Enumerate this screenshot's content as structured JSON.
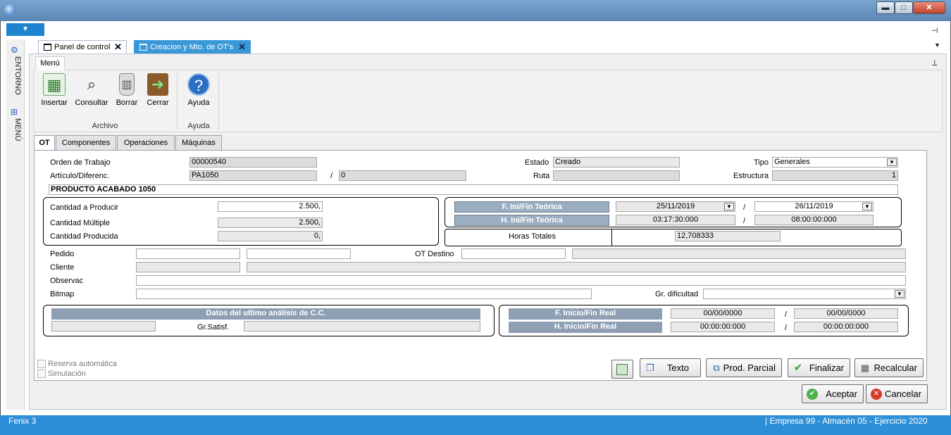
{
  "window": {
    "controls": {
      "minimize": "▬",
      "maximize": "□",
      "close": "✕"
    },
    "dropdown_glyph": "▼",
    "pin_glyph": "⊣",
    "tabs_overflow_glyph": "▼"
  },
  "side": {
    "entorno": "ENTORNO",
    "menu": "MENÚ"
  },
  "doc_tabs": [
    {
      "label": "Panel de control",
      "close": "✕"
    },
    {
      "label": "Creacion y Mto. de OT's",
      "close": "✕"
    }
  ],
  "ribbon": {
    "tab": "Menú",
    "pin": "⊥",
    "buttons": {
      "insertar": "Insertar",
      "consultar": "Consultar",
      "borrar": "Borrar",
      "cerrar": "Cerrar",
      "ayuda": "Ayuda"
    },
    "groups": {
      "archivo": "Archivo",
      "ayuda": "Ayuda"
    }
  },
  "form_tabs": [
    "OT",
    "Componentes",
    "Operaciones",
    "Máquinas"
  ],
  "ot": {
    "orden_label": "Orden de Trabajo",
    "orden": "00000540",
    "articulo_label": "Artículo/Diferenc.",
    "articulo": "PA1050",
    "slash": "/",
    "diferenc": "0",
    "estado_label": "Estado",
    "estado": "Creado",
    "ruta_label": "Ruta",
    "ruta": "",
    "tipo_label": "Tipo",
    "tipo": "Generales",
    "estructura_label": "Estructura",
    "estructura": "1",
    "descripcion": "PRODUCTO ACABADO 1050",
    "cantidad_producir_label": "Cantidad a Producir",
    "cantidad_producir": "2.500,",
    "cantidad_multiple_label": "Cantidad Múltiple",
    "cantidad_multiple": "2.500,",
    "cantidad_producida_label": "Cantidad Producida",
    "cantidad_producida": "0,",
    "f_teorica_label": "F. Ini/Fin Teórica",
    "f_ini": "25/11/2019",
    "f_fin": "26/11/2019",
    "h_teorica_label": "H. Ini/Fin Teórica",
    "h_ini": "03:17:30:000",
    "h_fin": "08:00:00:000",
    "horas_totales_label": "Horas Totales",
    "horas_totales": "12,708333",
    "pedido_label": "Pedido",
    "ot_destino_label": "OT Destino",
    "cliente_label": "Cliente",
    "observac_label": "Observac",
    "bitmap_label": "Bitmap",
    "gr_dificultad_label": "Gr. dificultad",
    "cc_title": "Datos del ultimo análisis de C.C.",
    "gr_satisf_label": "Gr.Satisf.",
    "f_real_label": "F. Inicio/Fin Real",
    "f_real_ini": "00/00/0000",
    "f_real_fin": "00/00/0000",
    "h_real_label": "H. Inicio/Fin Real",
    "h_real_ini": "00:00:00:000",
    "h_real_fin": "00:00:00:000",
    "reserva_label": "Reserva automática",
    "simulacion_label": "Simulación"
  },
  "buttons": {
    "texto": "Texto",
    "prod_parcial": "Prod. Parcial",
    "finalizar": "Finalizar",
    "recalcular": "Recalcular",
    "aceptar": "Aceptar",
    "cancelar": "Cancelar"
  },
  "status": {
    "app": "Fenix 3",
    "context": "| Empresa 99 -  Almacén 05 -  Ejercicio 2020"
  },
  "colors": {
    "accent": "#2c8fd8",
    "active_tab": "#3a98d8",
    "section_bar": "#8e9fb3"
  }
}
